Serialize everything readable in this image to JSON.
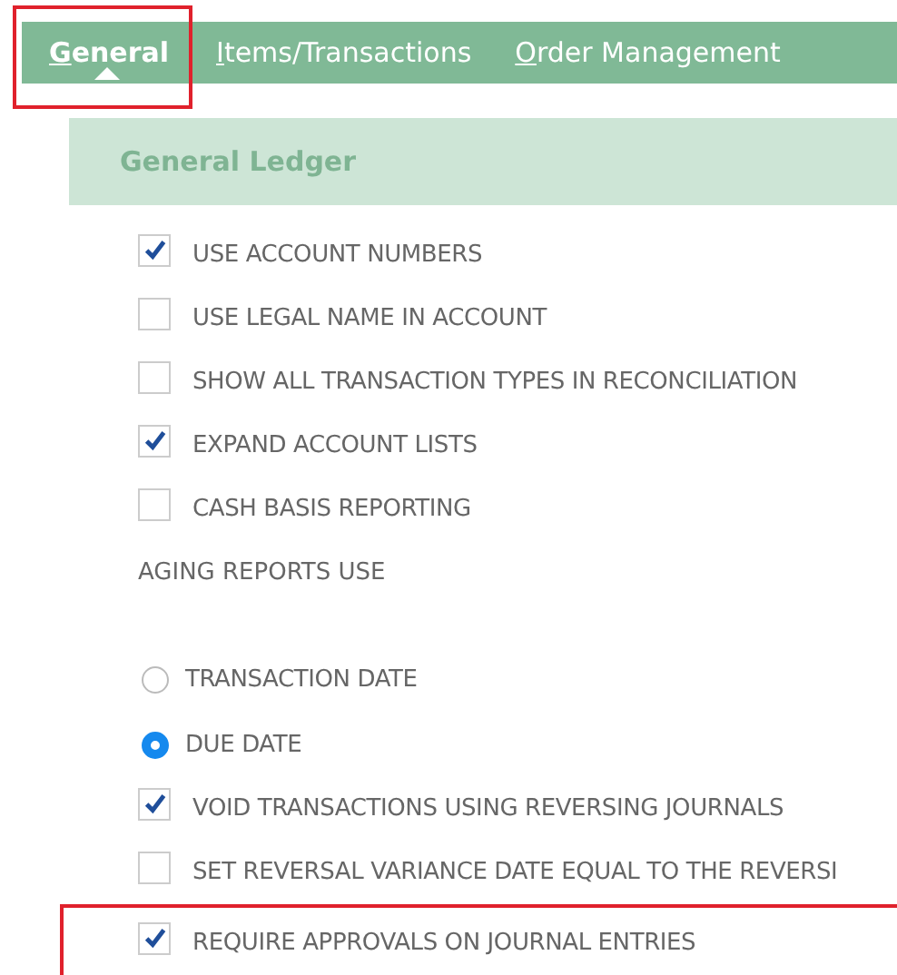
{
  "tabs": [
    {
      "label": "General",
      "selected": true,
      "highlighted": true
    },
    {
      "label": "Items/Transactions",
      "selected": false,
      "highlighted": false
    },
    {
      "label": "Order Management",
      "selected": false,
      "highlighted": false
    }
  ],
  "section": {
    "title": "General Ledger"
  },
  "items": [
    {
      "kind": "checkbox",
      "label": "USE ACCOUNT NUMBERS",
      "checked": true,
      "highlighted": false
    },
    {
      "kind": "checkbox",
      "label": "USE LEGAL NAME IN ACCOUNT",
      "checked": false,
      "highlighted": false
    },
    {
      "kind": "checkbox",
      "label": "SHOW ALL TRANSACTION TYPES IN RECONCILIATION",
      "checked": false,
      "highlighted": false
    },
    {
      "kind": "checkbox",
      "label": "EXPAND ACCOUNT LISTS",
      "checked": true,
      "highlighted": false
    },
    {
      "kind": "checkbox",
      "label": "CASH BASIS REPORTING",
      "checked": false,
      "highlighted": false
    },
    {
      "kind": "heading",
      "label": "AGING REPORTS USE"
    },
    {
      "kind": "radio",
      "label": "TRANSACTION DATE",
      "selected": false,
      "highlighted": false
    },
    {
      "kind": "radio",
      "label": "DUE DATE",
      "selected": true,
      "highlighted": false
    },
    {
      "kind": "checkbox",
      "label": "VOID TRANSACTIONS USING REVERSING JOURNALS",
      "checked": true,
      "highlighted": false
    },
    {
      "kind": "checkbox",
      "label": "SET REVERSAL VARIANCE DATE EQUAL TO THE REVERSI",
      "checked": false,
      "highlighted": false
    },
    {
      "kind": "checkbox",
      "label": "REQUIRE APPROVALS ON JOURNAL ENTRIES",
      "checked": true,
      "highlighted": true
    }
  ]
}
